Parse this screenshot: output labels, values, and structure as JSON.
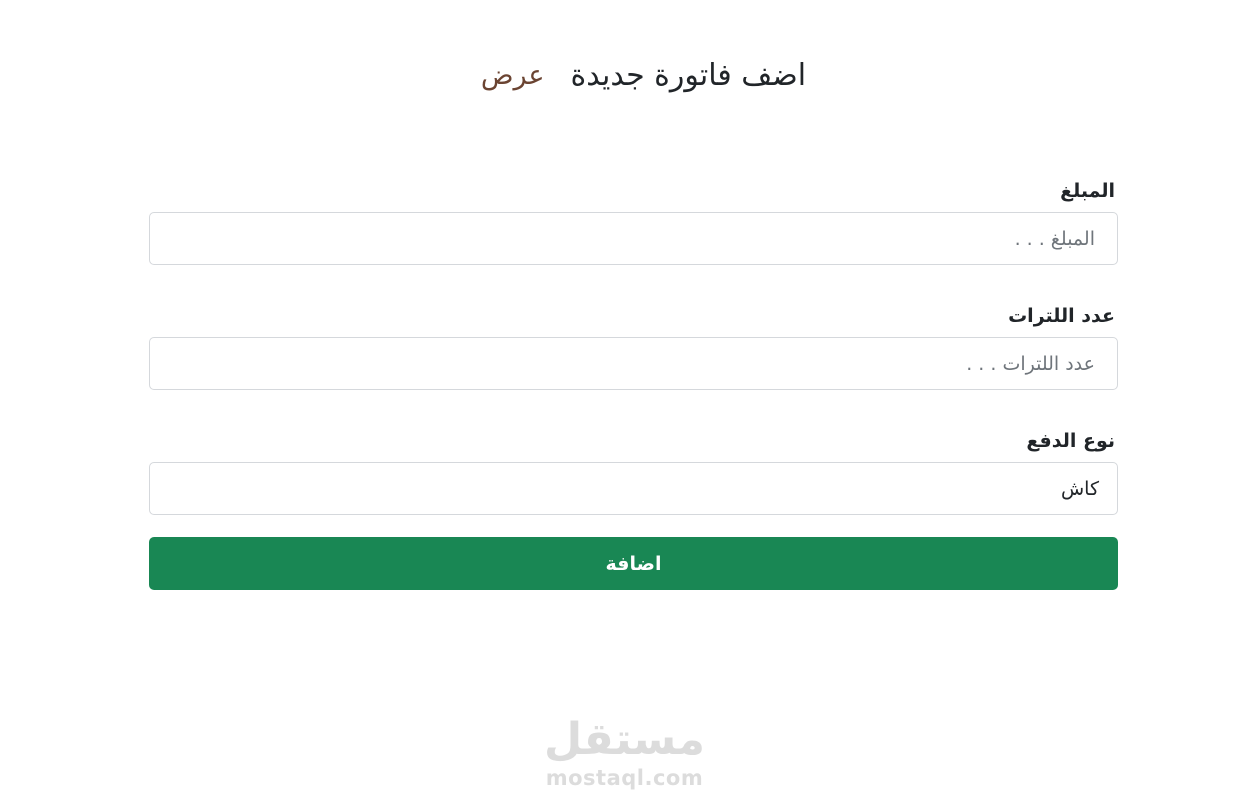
{
  "header": {
    "title": "اضف فاتورة جديدة",
    "view_link": "عرض"
  },
  "form": {
    "amount": {
      "label": "المبلغ",
      "placeholder": "المبلغ . . .",
      "value": ""
    },
    "liters": {
      "label": "عدد اللترات",
      "placeholder": "عدد اللترات . . .",
      "value": ""
    },
    "payment_type": {
      "label": "نوع الدفع",
      "selected": "كاش"
    },
    "submit_label": "اضافة"
  },
  "watermark": {
    "logo_text": "مستقل",
    "url": "mostaql.com"
  },
  "colors": {
    "primary_button": "#198754",
    "link": "#6b4432",
    "input_border": "#d5d8dc",
    "watermark": "#dcdcdc"
  }
}
